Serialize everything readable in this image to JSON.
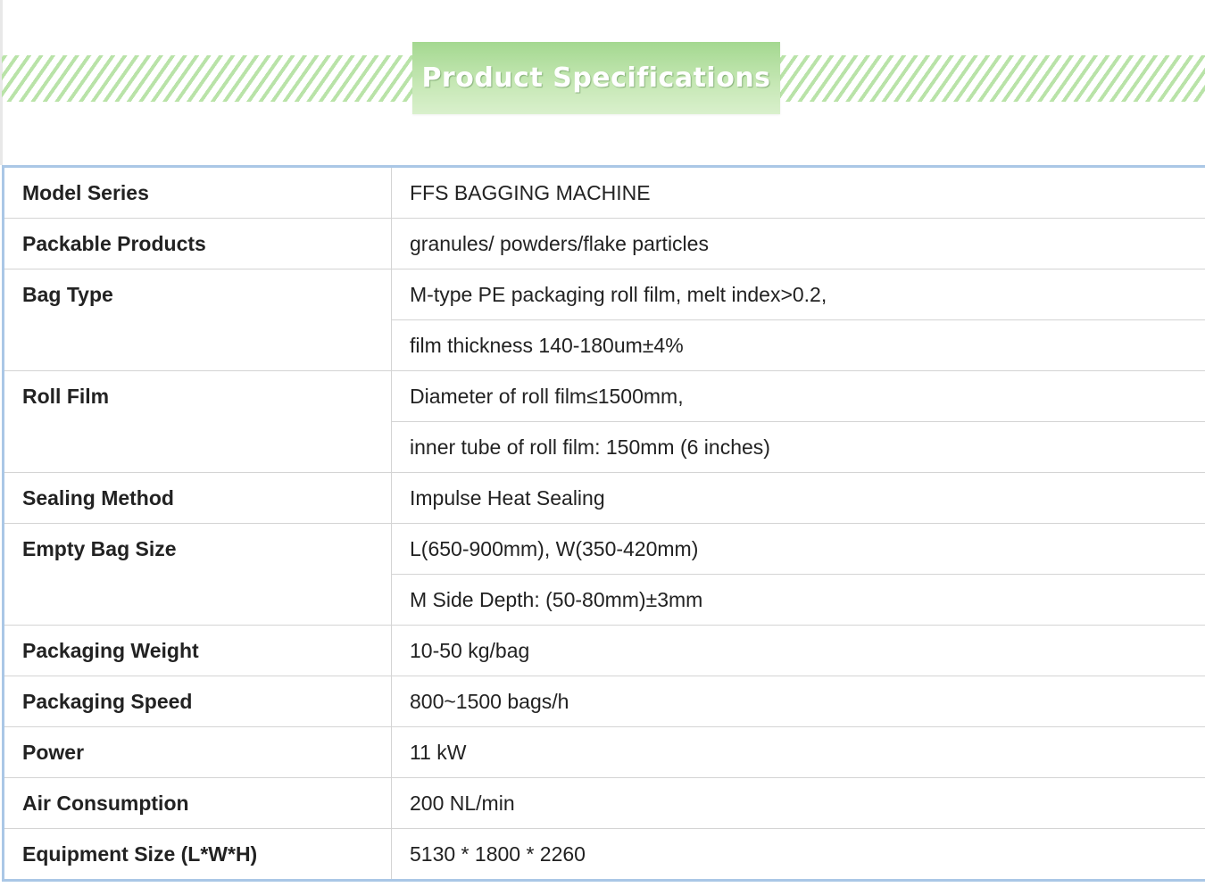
{
  "banner": {
    "title": "Product Specifications"
  },
  "specs": {
    "model_series": {
      "label": "Model Series",
      "values": [
        "FFS BAGGING MACHINE"
      ]
    },
    "packable_products": {
      "label": "Packable Products",
      "values": [
        "granules/ powders/flake particles"
      ]
    },
    "bag_type": {
      "label": "Bag Type",
      "values": [
        "M-type PE packaging roll film, melt index>0.2,",
        "film thickness 140-180um±4%"
      ]
    },
    "roll_film": {
      "label": "Roll Film",
      "values": [
        "Diameter of roll film≤1500mm,",
        "inner tube of roll film: 150mm (6 inches)"
      ]
    },
    "sealing_method": {
      "label": "Sealing Method",
      "values": [
        "Impulse Heat Sealing"
      ]
    },
    "empty_bag_size": {
      "label": "Empty Bag Size",
      "values": [
        "L(650-900mm), W(350-420mm)",
        "M Side Depth: (50-80mm)±3mm"
      ]
    },
    "packaging_weight": {
      "label": "Packaging Weight",
      "values": [
        "10-50 kg/bag"
      ]
    },
    "packaging_speed": {
      "label": "Packaging Speed",
      "values": [
        "800~1500 bags/h"
      ]
    },
    "power": {
      "label": "Power",
      "values": [
        "11 kW"
      ]
    },
    "air_consumption": {
      "label": "Air Consumption",
      "values": [
        "200 NL/min"
      ]
    },
    "equipment_size": {
      "label": "Equipment Size (L*W*H)",
      "values": [
        "5130 * 1800 * 2260"
      ]
    }
  },
  "colors": {
    "banner_green": "#a4d890",
    "stripe_green": "#b9e3a8",
    "table_frame_blue": "#aac7e6",
    "grid_gray": "#d4d4d4",
    "text": "#222222"
  }
}
